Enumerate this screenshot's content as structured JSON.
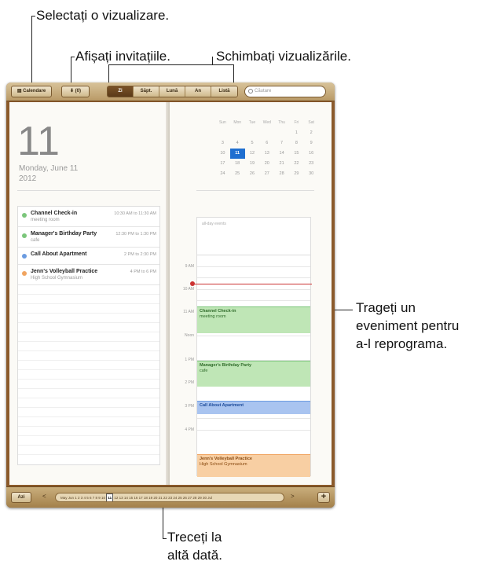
{
  "callouts": {
    "select_view": "Selectați o vizualizare.",
    "show_invites": "Afișați invitațiile.",
    "change_views": "Schimbați vizualizările.",
    "drag_event": [
      "Trageți un",
      "eveniment pentru",
      "a-l reprograma."
    ],
    "goto_date": [
      "Treceți la",
      "altă dată."
    ]
  },
  "toolbar": {
    "calendars_label": "Calendare",
    "invites_label": "(0)",
    "views": [
      "Zi",
      "Săpt.",
      "Lună",
      "An",
      "Listă"
    ],
    "active_view": "Zi",
    "search_placeholder": "Căutare"
  },
  "day": {
    "number": "11",
    "weekday_date": "Monday, June 11",
    "year": "2012"
  },
  "events": [
    {
      "title": "Channel Check-in",
      "subtitle": "meeting room",
      "time": "10:30 AM to 11:30 AM",
      "color": "#7bc67b"
    },
    {
      "title": "Manager's Birthday Party",
      "subtitle": "cafe",
      "time": "12:30 PM to 1:30 PM",
      "color": "#7bc67b"
    },
    {
      "title": "Call About Apartment",
      "subtitle": "",
      "time": "2 PM to 2:30 PM",
      "color": "#6b9be0"
    },
    {
      "title": "Jenn's Volleyball Practice",
      "subtitle": "High School Gymnasium",
      "time": "4 PM to 6 PM",
      "color": "#f0a460"
    }
  ],
  "minical": {
    "headers": [
      "Sun",
      "Mon",
      "Tue",
      "Wed",
      "Thu",
      "Fri",
      "Sat"
    ],
    "weeks": [
      [
        "",
        "",
        "",
        "",
        "",
        "1",
        "2"
      ],
      [
        "3",
        "4",
        "5",
        "6",
        "7",
        "8",
        "9"
      ],
      [
        "10",
        "11",
        "12",
        "13",
        "14",
        "15",
        "16"
      ],
      [
        "17",
        "18",
        "19",
        "20",
        "21",
        "22",
        "23"
      ],
      [
        "24",
        "25",
        "26",
        "27",
        "28",
        "29",
        "30"
      ]
    ],
    "selected": "11"
  },
  "dayview": {
    "allday_label": "all-day events",
    "hours": [
      "9 AM",
      "10 AM",
      "11 AM",
      "Noon",
      "1 PM",
      "2 PM",
      "3 PM",
      "4 PM"
    ],
    "blocks": [
      {
        "title": "Channel Check-in",
        "subtitle": "meeting room",
        "bg": "#bfe6b6",
        "border": "#7bc67b",
        "fg": "#2f6b2a"
      },
      {
        "title": "Manager's Birthday Party",
        "subtitle": "cafe",
        "bg": "#bfe6b6",
        "border": "#7bc67b",
        "fg": "#2f6b2a"
      },
      {
        "title": "Call About Apartment",
        "subtitle": "",
        "bg": "#a9c4f0",
        "border": "#6b9be0",
        "fg": "#1d4b9a"
      },
      {
        "title": "Jenn's Volleyball Practice",
        "subtitle": "High School Gymnasium",
        "bg": "#f8cfa3",
        "border": "#f0a460",
        "fg": "#8a4b12"
      }
    ]
  },
  "bottombar": {
    "today_label": "Azi",
    "timeline_text": "May   Jun 1 2 3 4 5 6 7 8 9 10",
    "current_day": "11",
    "timeline_after": "12 13 14 15 16 17 18 19 20 21 22 23 24 25 26 27 28 29 30   Jul",
    "add_label": "+"
  },
  "colors": {
    "wood": "#8b5a2b",
    "accent": "#1f6fd0",
    "now_line": "#cc3333"
  }
}
